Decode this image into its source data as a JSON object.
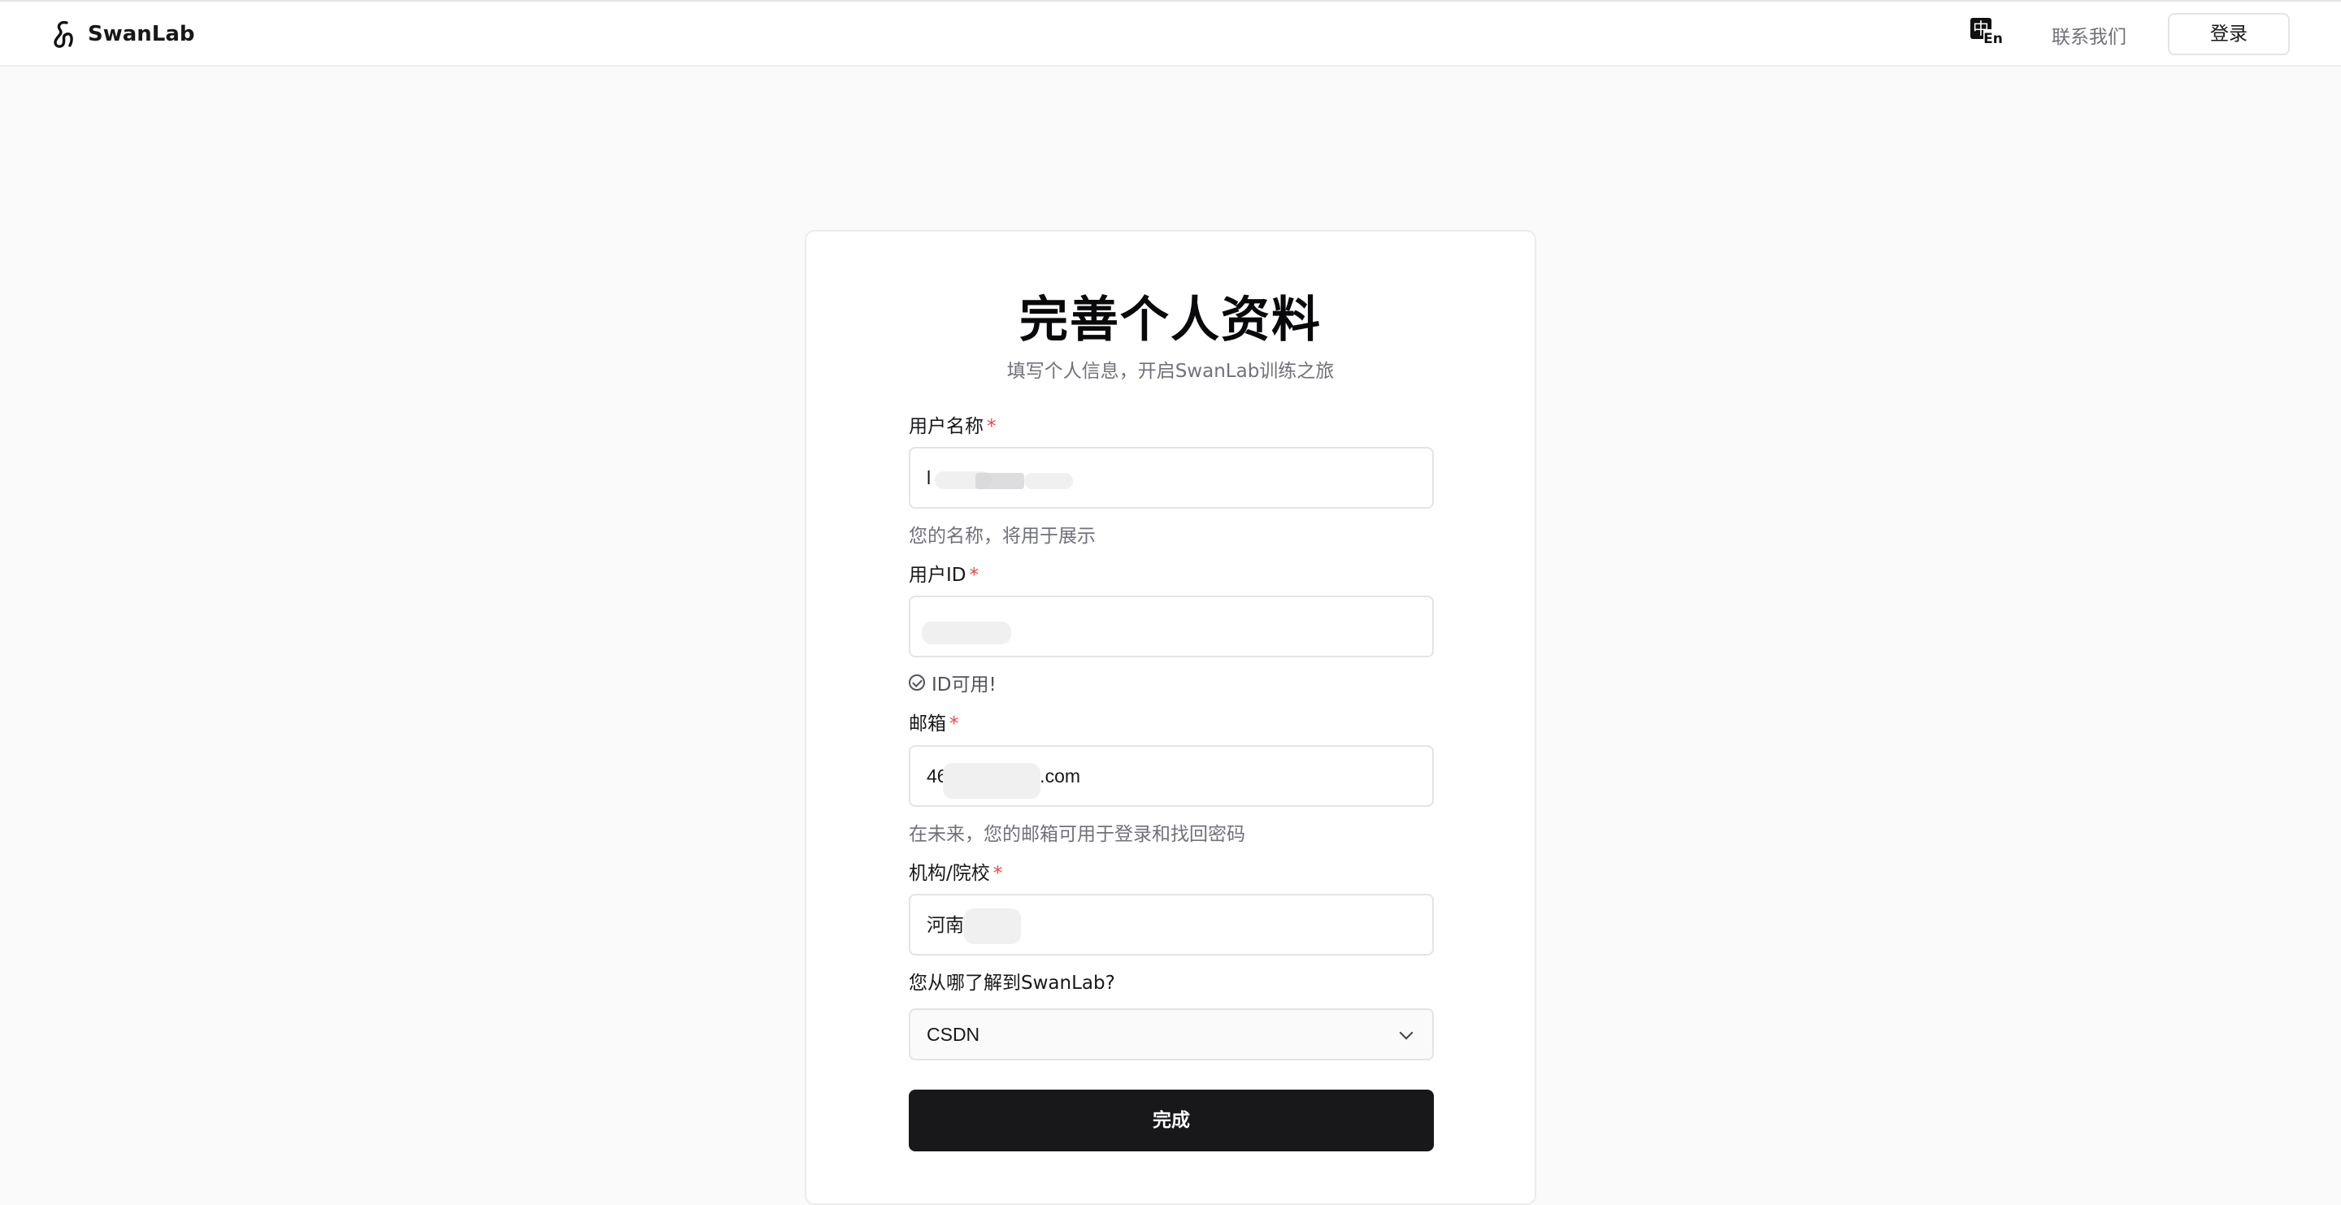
{
  "header": {
    "brand": "SwanLab",
    "lang_zh": "中",
    "lang_en": "En",
    "contact": "联系我们",
    "login": "登录"
  },
  "form": {
    "title": "完善个人资料",
    "subtitle": "填写个人信息，开启SwanLab训练之旅",
    "username": {
      "label": "用户名称",
      "required": "*",
      "value": "l",
      "hint": "您的名称，将用于展示"
    },
    "userid": {
      "label": "用户ID",
      "required": "*",
      "value": "",
      "status": "ID可用!"
    },
    "email": {
      "label": "邮箱",
      "required": "*",
      "value_prefix": "46",
      "value_suffix": "qq.com",
      "hint": "在未来，您的邮箱可用于登录和找回密码"
    },
    "org": {
      "label": "机构/院校",
      "required": "*",
      "value": "河南"
    },
    "source": {
      "label": "您从哪了解到SwanLab?",
      "selected": "CSDN"
    },
    "submit": "完成"
  },
  "colors": {
    "accent": "#18181b",
    "required": "#ef4444",
    "muted_text": "#71717a",
    "background": "#fafafa"
  },
  "icons": [
    "swanlab-logo-icon",
    "language-switch-icon",
    "check-circle-icon",
    "chevron-down-icon"
  ]
}
